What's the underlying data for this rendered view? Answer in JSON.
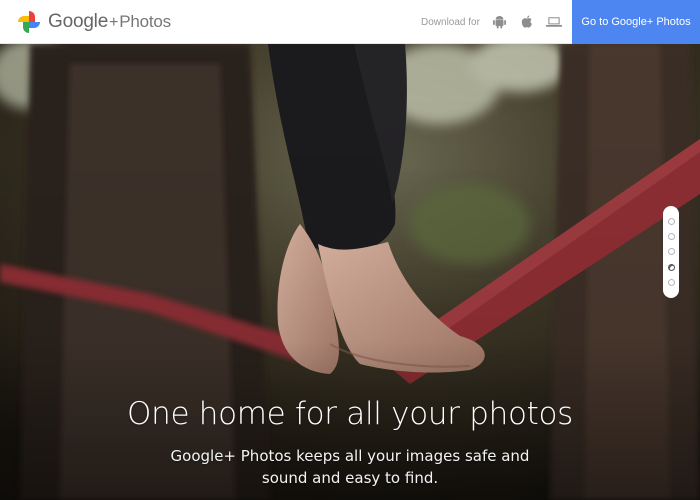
{
  "header": {
    "brand_name": "Google",
    "brand_plus": "+",
    "brand_sub": "Photos",
    "download_label": "Download for",
    "platforms": [
      {
        "name": "android",
        "icon": "android-icon"
      },
      {
        "name": "apple",
        "icon": "apple-icon"
      },
      {
        "name": "desktop",
        "icon": "laptop-icon"
      }
    ],
    "cta_label": "Go to Google+ Photos",
    "cta_color": "#4d86f0"
  },
  "hero": {
    "headline": "One home for all your photos",
    "subline": "Google+ Photos keeps all your images safe and sound and easy to find.",
    "slides_total": 5,
    "active_slide": 4
  }
}
